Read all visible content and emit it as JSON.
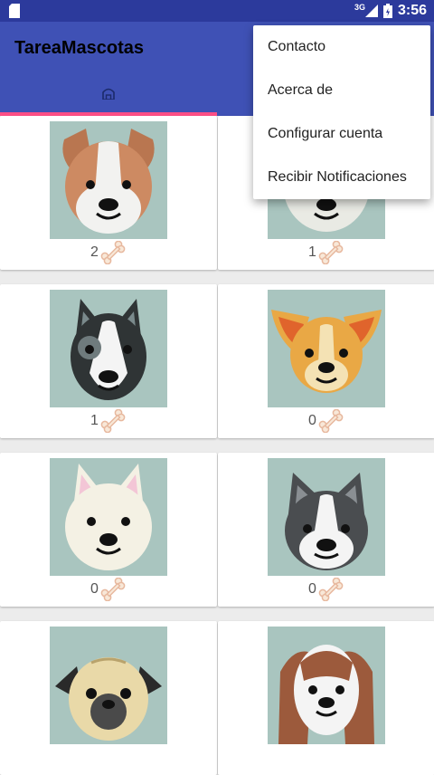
{
  "status_bar": {
    "network": "3G",
    "time": "3:56"
  },
  "app_bar": {
    "title": "TareaMascotas"
  },
  "tabs": [
    {
      "icon": "home-icon",
      "selected": true
    }
  ],
  "pets": [
    {
      "likes": "2",
      "breed_icon": "jack-russell-dog-icon"
    },
    {
      "likes": "1",
      "breed_icon": "dog-icon"
    },
    {
      "likes": "1",
      "breed_icon": "husky-dog-icon"
    },
    {
      "likes": "0",
      "breed_icon": "chihuahua-dog-icon"
    },
    {
      "likes": "0",
      "breed_icon": "white-dog-icon"
    },
    {
      "likes": "0",
      "breed_icon": "bulldog-icon"
    },
    {
      "likes": "",
      "breed_icon": "pug-dog-icon"
    },
    {
      "likes": "",
      "breed_icon": "spaniel-dog-icon"
    }
  ],
  "overflow_menu": {
    "items": [
      "Contacto",
      "Acerca de",
      "Configurar cuenta",
      "Recibir Notificaciones"
    ]
  },
  "colors": {
    "primary": "#3f51b5",
    "primary_dark": "#2c3a9c",
    "accent": "#ff4f86",
    "photo_bg": "#a9c5bf"
  }
}
